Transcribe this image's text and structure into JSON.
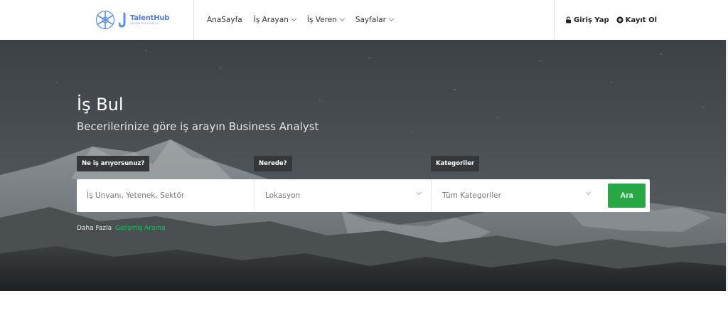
{
  "brand": {
    "name": "TalentHub",
    "tagline": "HUMAN RESOURCES",
    "accent": "#4a7fd8"
  },
  "nav": {
    "items": [
      {
        "label": "AnaSayfa",
        "dropdown": false
      },
      {
        "label": "İş Arayan",
        "dropdown": true
      },
      {
        "label": "İş Veren",
        "dropdown": true
      },
      {
        "label": "Sayfalar",
        "dropdown": true
      }
    ]
  },
  "auth": {
    "login_label": "Giriş Yap",
    "login_icon": "lock-icon",
    "register_label": "Kayıt Ol",
    "register_icon": "plus-circle-icon"
  },
  "hero": {
    "title": "İş Bul",
    "subtitle": "Becerilerinize göre iş arayın Business Analyst"
  },
  "search": {
    "what_label": "Ne iş arıyorsunuz?",
    "where_label": "Nerede?",
    "category_label": "Kategoriler",
    "what_placeholder": "İş Unvanı, Yetenek, Sektör",
    "where_value": "Lokasyon",
    "category_value": "Tüm Kategoriler",
    "button_label": "Ara",
    "button_color": "#28a745"
  },
  "advanced": {
    "prefix": "Daha Fazla",
    "link": "Gelişmiş Arama",
    "link_color": "#2bbf5b"
  }
}
